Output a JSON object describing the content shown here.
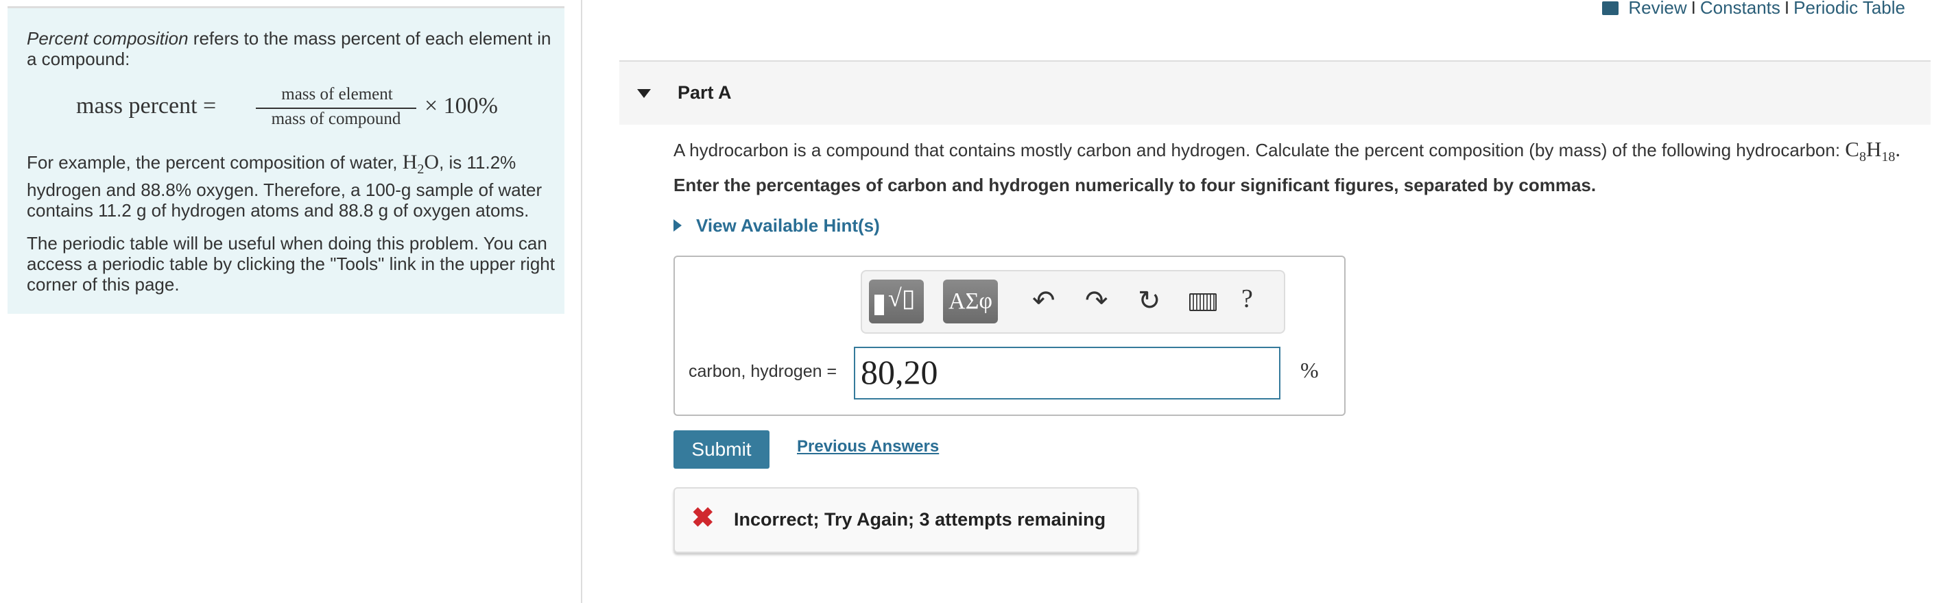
{
  "top_links": {
    "icon": "book-icon",
    "review": "Review",
    "constants": "Constants",
    "periodic_table": "Periodic Table",
    "separator": "I"
  },
  "intro": {
    "p1_em": "Percent composition",
    "p1_rest": " refers to the mass percent of each element in a compound:",
    "formula": {
      "lhs": "mass percent =",
      "numerator": "mass of element",
      "denominator": "mass of compound",
      "times": "× 100%"
    },
    "p2_a": "For example, the percent composition of water, ",
    "p2_formula_h": "H",
    "p2_formula_sub": "2",
    "p2_formula_o": "O",
    "p2_b": ", is 11.2% hydrogen and 88.8% oxygen. Therefore, a 100-g sample of water contains 11.2 g of hydrogen atoms and 88.8 g of oxygen atoms.",
    "p3": "The periodic table will be useful when doing this problem. You can access a periodic table by clicking the \"Tools\" link in the upper right corner of this page."
  },
  "part": {
    "title": "Part A",
    "question": "A hydrocarbon is a compound that contains mostly carbon and hydrogen. Calculate the percent composition (by mass) of the following hydrocarbon: ",
    "formula_c": "C",
    "formula_c_sub": "8",
    "formula_h": "H",
    "formula_h_sub": "18",
    "formula_end": ".",
    "instruction": "Enter the percentages of carbon and hydrogen numerically to four significant figures, separated by commas.",
    "hint_link": "View Available Hint(s)"
  },
  "toolbar": {
    "templates_icon": "templates-icon",
    "greek": "ΑΣφ",
    "undo": "undo-icon",
    "redo": "redo-icon",
    "reset": "reset-icon",
    "keyboard": "keyboard-icon",
    "help": "?"
  },
  "answer": {
    "label": "carbon, hydrogen =",
    "value": "80,20",
    "unit": "%"
  },
  "actions": {
    "submit": "Submit",
    "previous_answers": "Previous Answers"
  },
  "feedback": {
    "icon": "x-icon",
    "text": "Incorrect; Try Again; 3 attempts remaining",
    "icon_color": "#d0282e"
  },
  "colors": {
    "accent": "#367b9c",
    "link": "#2a6e94",
    "intro_bg": "#e9f5f7"
  }
}
